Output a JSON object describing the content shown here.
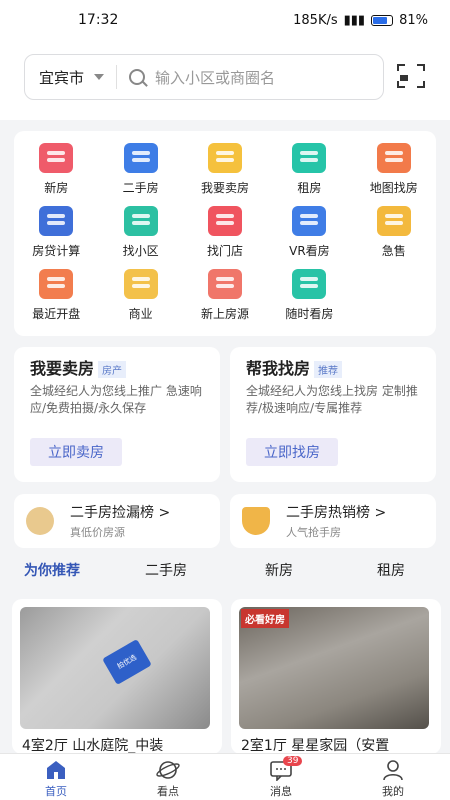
{
  "status": {
    "time": "17:32",
    "network": "185K/s",
    "battery": "81%"
  },
  "header": {
    "city": "宜宾市",
    "search_placeholder": "输入小区或商圈名"
  },
  "grid": [
    {
      "label": "新房",
      "color": "#ef5b6a",
      "icon": "building-icon"
    },
    {
      "label": "二手房",
      "color": "#3e7de6",
      "icon": "building-icon"
    },
    {
      "label": "我要卖房",
      "color": "#f5c13d",
      "icon": "tag-icon"
    },
    {
      "label": "租房",
      "color": "#26c4a8",
      "icon": "suitcase-icon"
    },
    {
      "label": "地图找房",
      "color": "#f27a4a",
      "icon": "map-pin-icon"
    },
    {
      "label": "房贷计算",
      "color": "#3f6fd9",
      "icon": "calculator-icon"
    },
    {
      "label": "找小区",
      "color": "#2cc0a2",
      "icon": "buildings-icon"
    },
    {
      "label": "找门店",
      "color": "#f0545f",
      "icon": "store-icon"
    },
    {
      "label": "VR看房",
      "color": "#3f7de6",
      "icon": "vr-icon"
    },
    {
      "label": "急售",
      "color": "#f3b93d",
      "icon": "sale-icon"
    },
    {
      "label": "最近开盘",
      "color": "#f27d4e",
      "icon": "house-search-icon"
    },
    {
      "label": "商业",
      "color": "#f3c14a",
      "icon": "office-icon"
    },
    {
      "label": "新上房源",
      "color": "#f0766a",
      "icon": "new-building-icon"
    },
    {
      "label": "随时看房",
      "color": "#28c3a6",
      "icon": "bus-icon"
    }
  ],
  "promos": [
    {
      "title": "我要卖房",
      "tag": "房产",
      "desc": "全城经纪人为您线上推广 急速响应/免费拍摄/永久保存",
      "button": "立即卖房"
    },
    {
      "title": "帮我找房",
      "tag": "推荐",
      "desc": "全城经纪人为您线上找房 定制推荐/极速响应/专属推荐",
      "button": "立即找房"
    }
  ],
  "ranks": [
    {
      "title": "二手房捡漏榜 >",
      "sub": "真低价房源",
      "medal": "#e9c98e"
    },
    {
      "title": "二手房热销榜 >",
      "sub": "人气抢手房",
      "medal": "#f0b548"
    }
  ],
  "tabs": [
    "为你推荐",
    "二手房",
    "新房",
    "租房"
  ],
  "listings": [
    {
      "title": "4室2厅  山水庭院_中装",
      "ribbon": "拍优选"
    },
    {
      "title": "2室1厅  星星家园（安置",
      "badge": "必看好房"
    }
  ],
  "nav": [
    {
      "label": "首页",
      "icon": "home-icon",
      "active": true
    },
    {
      "label": "看点",
      "icon": "planet-icon"
    },
    {
      "label": "消息",
      "icon": "message-icon",
      "badge": "39"
    },
    {
      "label": "我的",
      "icon": "user-icon"
    }
  ]
}
